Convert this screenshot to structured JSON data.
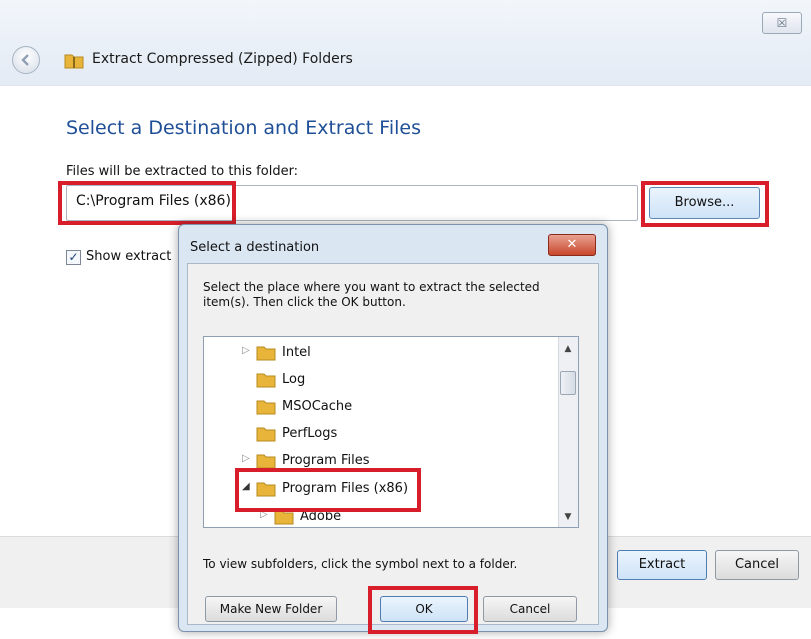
{
  "window": {
    "title": "Extract Compressed (Zipped) Folders",
    "close_glyph": "☒",
    "back_icon": "back-arrow-icon"
  },
  "main": {
    "heading": "Select a Destination and Extract Files",
    "dest_label": "Files will be extracted to this folder:",
    "path_value": "C:\\Program Files (x86)",
    "browse_label": "Browse...",
    "show_files_label": "Show extract",
    "show_files_checked": true,
    "extract_label": "Extract",
    "cancel_label": "Cancel"
  },
  "dialog": {
    "title": "Select a destination",
    "close_glyph": "✕",
    "description": "Select the place where you want to extract the selected item(s).  Then click the OK button.",
    "hint": "To view subfolders, click the symbol next to a folder.",
    "tree": [
      {
        "label": "Intel",
        "expander": "▷"
      },
      {
        "label": "Log",
        "expander": ""
      },
      {
        "label": "MSOCache",
        "expander": ""
      },
      {
        "label": "PerfLogs",
        "expander": ""
      },
      {
        "label": "Program Files",
        "expander": "▷"
      },
      {
        "label": "Program Files (x86)",
        "expander": "◢",
        "selected": true
      },
      {
        "label": "Adobe",
        "expander": "▷"
      }
    ],
    "make_folder_label": "Make New Folder",
    "ok_label": "OK",
    "cancel_label": "Cancel"
  },
  "colors": {
    "heading_blue": "#1f4f97",
    "highlight_red": "#d81e2a",
    "folder_yellow": "#e8b53a"
  }
}
